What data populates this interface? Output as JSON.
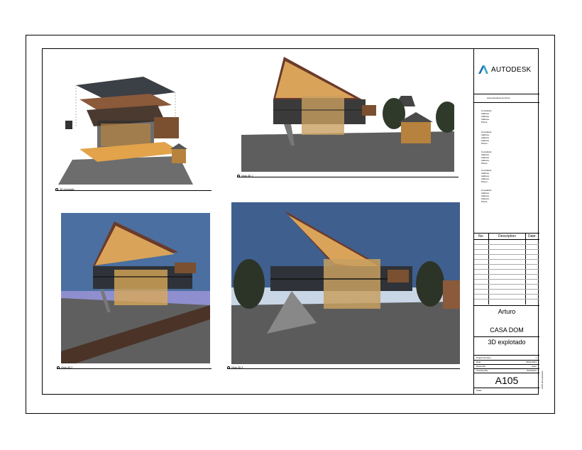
{
  "logo": {
    "text": "AUTODESK",
    "url": "www.autodesk.com/revit"
  },
  "consultants": [
    {
      "heading": "Consultant",
      "lines": [
        "Address",
        "Address",
        "Address",
        "Phone"
      ]
    },
    {
      "heading": "Consultant",
      "lines": [
        "Address",
        "Address",
        "Address",
        "Phone"
      ]
    },
    {
      "heading": "Consultant",
      "lines": [
        "Address",
        "Address",
        "Address",
        "Phone"
      ]
    },
    {
      "heading": "Consultant",
      "lines": [
        "Address",
        "Address",
        "Address",
        "Phone"
      ]
    },
    {
      "heading": "Consultant",
      "lines": [
        "Address",
        "Address",
        "Address",
        "Phone"
      ]
    }
  ],
  "revisions": {
    "col_no": "No.",
    "col_desc": "Description",
    "col_date": "Date"
  },
  "project": {
    "owner": "Arturo",
    "name": "CASA DOM",
    "sheet_name": "3D explotado"
  },
  "meta": {
    "project_number_label": "Project Number",
    "project_number_value": "1",
    "date_label": "Date",
    "date_value": "23/01/2023",
    "drawn_label": "Drawn By",
    "drawn_value": "Autor",
    "checked_label": "Checked By",
    "checked_value": "Verificador"
  },
  "sheet_number": "A105",
  "scale_label": "Scale",
  "side_text": "A105 3D explotado",
  "views": [
    {
      "label": "3D explotado",
      "num": "1"
    },
    {
      "label": "Vista 3D 1",
      "num": "2"
    },
    {
      "label": "Vista 3D 2",
      "num": "3"
    },
    {
      "label": "Vista 3D 3",
      "num": "4"
    }
  ],
  "colors": {
    "sky": "#4a6fa0",
    "wood": "#d9a45a",
    "roof": "#6b3a2a",
    "ground": "#5a5a5a"
  }
}
